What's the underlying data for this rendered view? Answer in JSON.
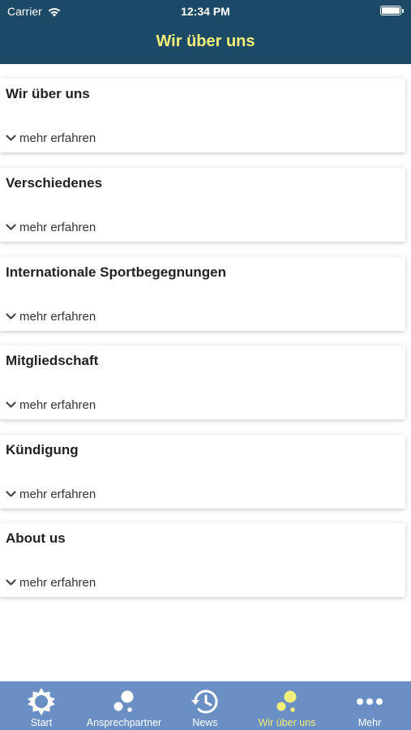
{
  "status_bar": {
    "carrier": "Carrier",
    "time": "12:34 PM"
  },
  "nav": {
    "title": "Wir über uns"
  },
  "sections": [
    {
      "title": "Wir über uns",
      "more_label": "mehr erfahren"
    },
    {
      "title": "Verschiedenes",
      "more_label": "mehr erfahren"
    },
    {
      "title": "Internationale Sportbegegnungen",
      "more_label": "mehr erfahren"
    },
    {
      "title": "Mitgliedschaft",
      "more_label": "mehr erfahren"
    },
    {
      "title": "Kündigung",
      "more_label": "mehr erfahren"
    },
    {
      "title": "About us",
      "more_label": "mehr erfahren"
    }
  ],
  "tabbar": {
    "tabs": [
      {
        "label": "Start",
        "icon": "sun-icon"
      },
      {
        "label": "Ansprechpartner",
        "icon": "contacts-dots-icon"
      },
      {
        "label": "News",
        "icon": "history-clock-icon"
      },
      {
        "label": "Wir über uns",
        "icon": "about-dots-icon"
      },
      {
        "label": "Mehr",
        "icon": "more-dots-icon"
      }
    ],
    "active_tab": "Wir über uns"
  },
  "colors": {
    "header": "#1c4966",
    "accent": "#f2ee7a",
    "tabbar": "#6a8fc4"
  }
}
